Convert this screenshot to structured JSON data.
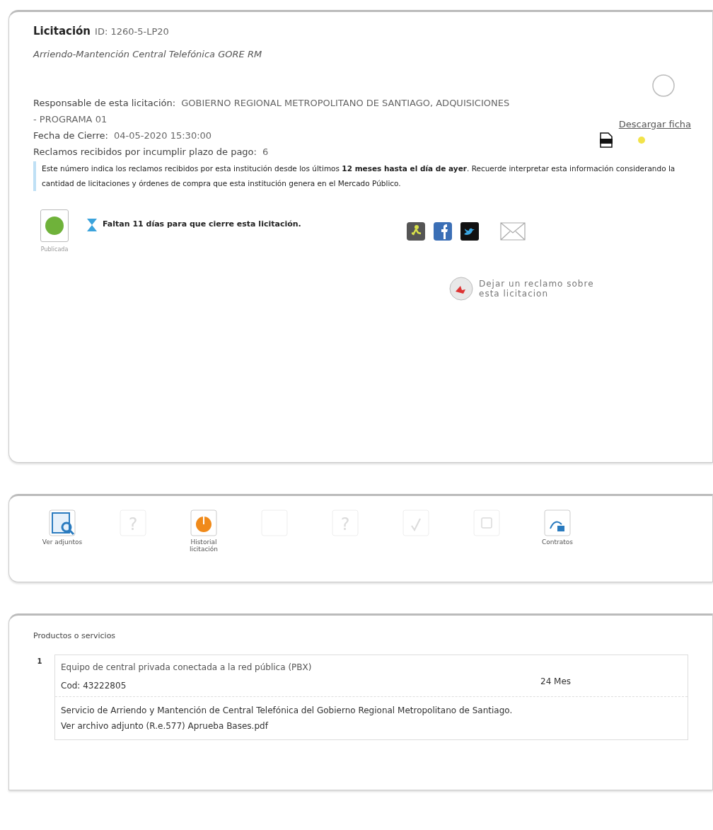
{
  "header": {
    "title": "Licitación",
    "id_label": "ID:",
    "id": "1260-5-LP20",
    "subtitle": "Arriendo-Mantención Central Telefónica GORE RM"
  },
  "info": [
    {
      "label": "Responsable de esta licitación:",
      "value": "GOBIERNO REGIONAL METROPOLITANO DE SANTIAGO, ADQUISICIONES - PROGRAMA 01"
    },
    {
      "label": "Fecha de Cierre:",
      "value": "04-05-2020 15:30:00"
    },
    {
      "label": "Reclamos recibidos por incumplir plazo de pago:",
      "value": "6"
    }
  ],
  "download": {
    "label": "Descargar ficha"
  },
  "note": "Este número indica los reclamos recibidos por esta institución desde los últimos **12 meses hasta el día de ayer**. Recuerde interpretar esta información considerando la cantidad de licitaciones y órdenes de compra que esta institución genera en el Mercado Público.",
  "status": {
    "label": "Publicada",
    "countdown": "Faltan 11 días para que cierre esta licitación."
  },
  "share": [
    {
      "kind": "web"
    },
    {
      "kind": "facebook"
    },
    {
      "kind": "twitter"
    },
    {
      "kind": "mail"
    }
  ],
  "complaint": {
    "label": "Dejar un reclamo sobre esta licitacion"
  },
  "toolbar": [
    {
      "kind": "attachments",
      "label": "Ver adjuntos",
      "disabled": false
    },
    {
      "kind": "question",
      "glyph": "?",
      "disabled": true
    },
    {
      "kind": "history",
      "label": "Historial licitación",
      "disabled": false
    },
    {
      "kind": "blank",
      "disabled": true
    },
    {
      "kind": "question",
      "glyph": "?",
      "disabled": true
    },
    {
      "kind": "check",
      "disabled": true
    },
    {
      "kind": "square",
      "disabled": true
    },
    {
      "kind": "contracts",
      "label": "Contratos",
      "disabled": false
    }
  ],
  "products": {
    "title": "Productos o servicios",
    "items": [
      {
        "number": "1",
        "name": "Equipo de central privada conectada a la red pública (PBX)",
        "code": "Cod: 43222805",
        "quantity": "24 Mes",
        "description": "Servicio de Arriendo y Mantención de Central Telefónica del Gobierno Regional Metropolitano de Santiago. Ver archivo adjunto (R.e.577) Aprueba Bases.pdf"
      }
    ]
  }
}
